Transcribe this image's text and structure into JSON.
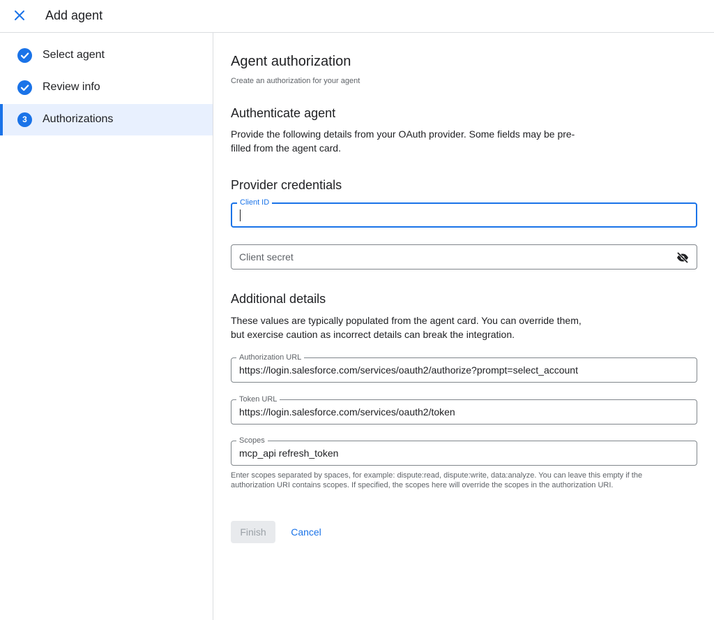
{
  "header": {
    "title": "Add agent",
    "close_icon": "close-icon"
  },
  "sidebar": {
    "steps": [
      {
        "label": "Select agent",
        "status": "complete",
        "icon": "check-circle-icon"
      },
      {
        "label": "Review info",
        "status": "complete",
        "icon": "check-circle-icon"
      },
      {
        "label": "Authorizations",
        "status": "active",
        "number": "3"
      }
    ]
  },
  "main": {
    "title": "Agent authorization",
    "subtitle": "Create an authorization for your agent",
    "authenticate": {
      "heading": "Authenticate agent",
      "description_line1": "Provide the following details from your OAuth provider. Some fields may be pre-",
      "description_line2": "filled from the agent card."
    },
    "provider_credentials": {
      "heading": "Provider credentials",
      "client_id": {
        "label": "Client ID",
        "value": ""
      },
      "client_secret": {
        "placeholder": "Client secret",
        "icon": "visibility-off-icon"
      }
    },
    "additional_details": {
      "heading": "Additional details",
      "description_line1": "These values are typically populated from the agent card. You can override them,",
      "description_line2": "but exercise caution as incorrect details can break the integration.",
      "authorization_url": {
        "label": "Authorization URL",
        "value": "https://login.salesforce.com/services/oauth2/authorize?prompt=select_account"
      },
      "token_url": {
        "label": "Token URL",
        "value": "https://login.salesforce.com/services/oauth2/token"
      },
      "scopes": {
        "label": "Scopes",
        "value": "mcp_api refresh_token"
      },
      "scopes_helper": "Enter scopes separated by spaces, for example: dispute:read, dispute:write, data:analyze. You can leave this empty if the authorization URI contains scopes. If specified, the scopes here will override the scopes in the authorization URI."
    },
    "actions": {
      "finish_label": "Finish",
      "cancel_label": "Cancel"
    }
  },
  "colors": {
    "accent": "#1a73e8",
    "active_step_bg": "#e8f0fe",
    "border": "#dadce0",
    "disabled_bg": "#e8eaed"
  }
}
